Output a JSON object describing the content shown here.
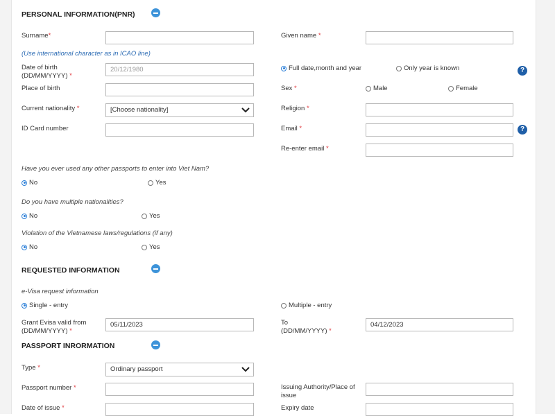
{
  "personal": {
    "title": "PERSONAL INFORMATION(PNR)",
    "surname_label": "Surname",
    "given_name_label": "Given name ",
    "icao_note": "(Use international character as in ICAO line)",
    "dob_label_1": "Date of birth",
    "dob_label_2": "(DD/MM/YYYY) ",
    "dob_value": "20/12/1980",
    "dob_full": "Full date,month and year",
    "dob_year_only": "Only year is known",
    "pob_label": "Place of birth",
    "sex_label": "Sex ",
    "sex_male": "Male",
    "sex_female": "Female",
    "nationality_label": "Current nationality ",
    "nationality_value": "[Choose nationality]",
    "religion_label": "Religion ",
    "id_card_label": "ID Card number",
    "email_label": "Email ",
    "reemail_label": "Re-enter email ",
    "q_other_passports": "Have you ever used any other passports to enter into Viet Nam?",
    "q_multiple_nationalities": "Do you have multiple nationalities?",
    "q_violation": "Violation of the Vietnamese laws/regulations (if any)",
    "no": "No",
    "yes": "Yes"
  },
  "requested": {
    "title": "REQUESTED INFORMATION",
    "evisa_note": "e-Visa request information",
    "single": "Single - entry",
    "multiple": "Multiple - entry",
    "from_label_1": "Grant Evisa valid from",
    "from_label_2": "(DD/MM/YYYY) ",
    "from_value": "05/11/2023",
    "to_label_1": "To",
    "to_label_2": "(DD/MM/YYYY) ",
    "to_value": "04/12/2023"
  },
  "passport": {
    "title": "PASSPORT INRORMATION",
    "type_label": "Type ",
    "type_value": "Ordinary passport",
    "number_label": "Passport number ",
    "authority_label_1": "Issuing Authority/Place of",
    "authority_label_2": "issue",
    "issue_date_label": "Date of issue ",
    "expiry_label": "Expiry date"
  },
  "common": {
    "required_mark": "*",
    "help_glyph": "?"
  },
  "colors": {
    "accent": "#3d93d9",
    "required": "#e0393e",
    "help": "#1f5fa8"
  }
}
